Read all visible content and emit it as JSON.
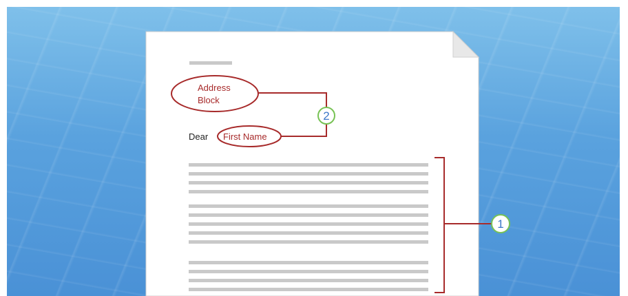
{
  "document": {
    "address_block_line1": "Address",
    "address_block_line2": "Block",
    "salutation": "Dear",
    "first_name_field": "First Name"
  },
  "callouts": {
    "callout_1": "1",
    "callout_2": "2"
  },
  "colors": {
    "desktop_blue": "#5aa2de",
    "field_outline_red": "#a72a2a",
    "badge_ring_green": "#77c254",
    "badge_number_blue": "#3c78c8",
    "placeholder_text_gray": "#c9c9c9"
  }
}
